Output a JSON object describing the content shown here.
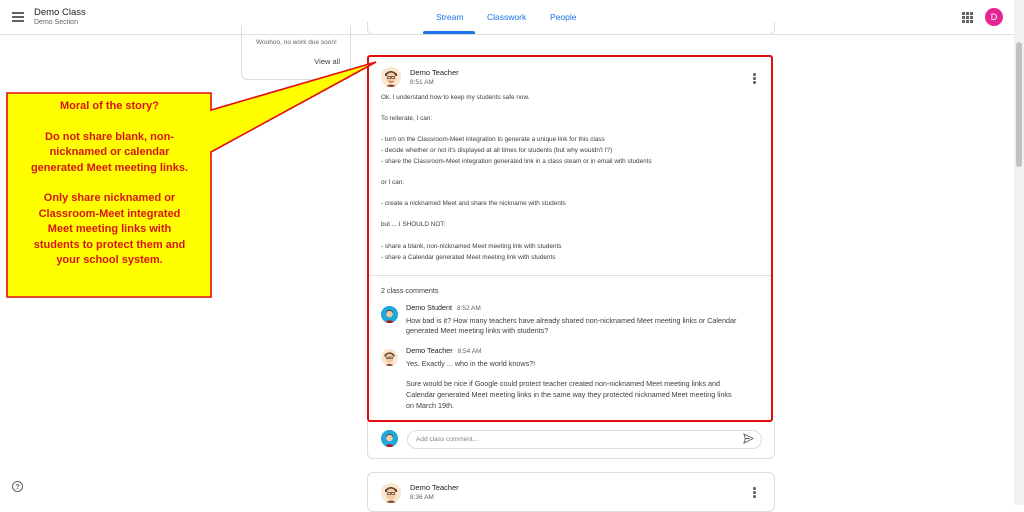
{
  "header": {
    "class_title": "Demo Class",
    "class_section": "Demo Section",
    "tabs": [
      {
        "label": "Stream",
        "active": true
      },
      {
        "label": "Classwork",
        "active": false
      },
      {
        "label": "People",
        "active": false
      }
    ],
    "user_initial": "D",
    "accent_color": "#1a73e8",
    "avatar_color": "#e52592"
  },
  "upcoming": {
    "text": "Woohoo, no work due soon!",
    "view_all": "View all"
  },
  "post": {
    "author": "Demo Teacher",
    "time": "8:51 AM",
    "lines": [
      "Ok. I understand how to keep my students safe now.",
      "To reiterate, I can:",
      "- turn on the Classroom-Meet integration to generate a unique link for this class",
      "- decide whether or not it's displayed at all times for students (but why wouldn't I?)",
      "- share the Classroom-Meet integration generated link in a class steam or in email with students",
      "or I can:",
      "- create a nicknamed Meet and share the nickname with students",
      "but ... I SHOULD NOT:",
      "- share a blank, non-nicknamed Meet meeting link with students",
      "- share a Calendar generated Meet meeting link with students"
    ],
    "comments_count": "2 class comments",
    "comments": [
      {
        "author": "Demo Student",
        "time": "8:52 AM",
        "lines": [
          "How bad is it? How many teachers have already shared non-nicknamed Meet meeting links or Calendar",
          "generated Meet meeting links with students?"
        ]
      },
      {
        "author": "Demo Teacher",
        "time": "8:54 AM",
        "lines": [
          "Yes. Exactly ... who in the world knows?!",
          "Sure would be nice if Google could protect teacher created non-nicknamed Meet meeting links and",
          "Calendar generated Meet meeting links in the same way they protected nicknamed Meet meeting links",
          "on March 19th."
        ]
      }
    ],
    "comment_placeholder": "Add class comment...",
    "highlight_color": "#e30d0d"
  },
  "post2": {
    "author": "Demo Teacher",
    "time": "8:36 AM"
  },
  "callout": {
    "lines": [
      "Moral of the story?",
      "",
      "Do not share blank, non-",
      "nicknamed or calendar",
      "generated Meet meeting links.",
      "",
      "Only share nicknamed or",
      "Classroom-Meet integrated",
      "Meet meeting links with",
      "students to protect them and",
      "your school system."
    ],
    "fill_color": "#ffff00",
    "text_color": "#d61515"
  },
  "icons": [
    "menu-icon",
    "apps-icon",
    "more-vert-icon",
    "send-icon",
    "help-icon"
  ]
}
